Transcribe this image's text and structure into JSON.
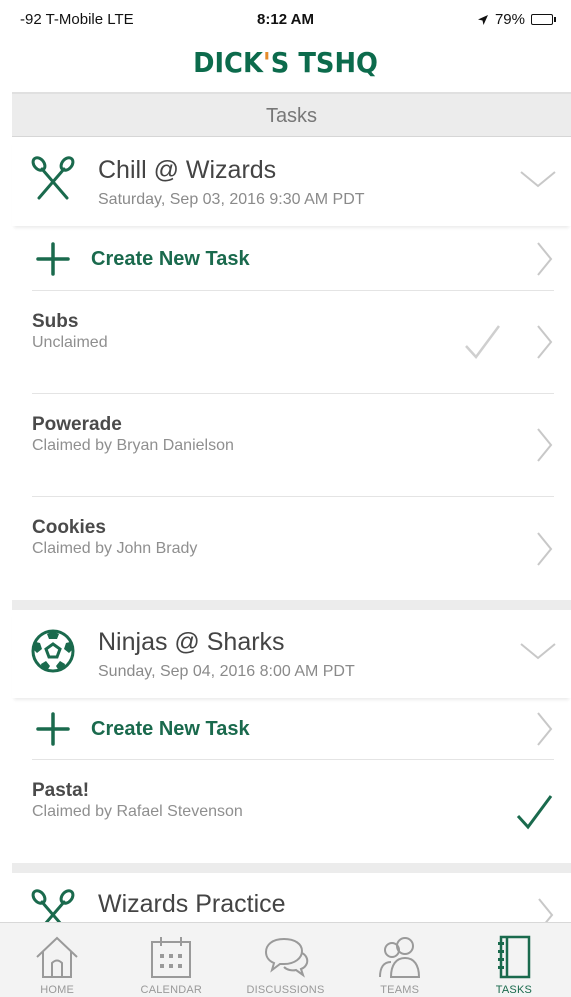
{
  "status_bar": {
    "carrier": "-92 T-Mobile  LTE",
    "time": "8:12 AM",
    "battery": "79%",
    "battery_level": 0.79
  },
  "brand": {
    "logo_part1": "DICK",
    "logo_apos": "'",
    "logo_part2": "S TSHQ",
    "primary_color": "#1a6a4d",
    "accent_color": "#e58b2b"
  },
  "header": {
    "title": "Tasks"
  },
  "events": [
    {
      "icon": "lacrosse-sticks-icon",
      "title": "Chill @ Wizards",
      "date": "Saturday, Sep 03, 2016 9:30 AM PDT",
      "create_label": "Create New Task",
      "tasks": [
        {
          "title": "Subs",
          "status": "Unclaimed",
          "claimed_by_me": false,
          "show_check": true
        },
        {
          "title": "Powerade",
          "status": "Claimed by Bryan Danielson",
          "claimed_by_me": false,
          "show_check": false
        },
        {
          "title": "Cookies",
          "status": "Claimed by John Brady",
          "claimed_by_me": false,
          "show_check": false
        }
      ]
    },
    {
      "icon": "soccer-ball-icon",
      "title": "Ninjas @ Sharks",
      "date": "Sunday, Sep 04, 2016 8:00 AM PDT",
      "create_label": "Create New Task",
      "tasks": [
        {
          "title": "Pasta!",
          "status": "Claimed by Rafael Stevenson",
          "claimed_by_me": true,
          "show_check": true
        }
      ]
    },
    {
      "icon": "lacrosse-sticks-icon",
      "title": "Wizards Practice"
    }
  ],
  "tab_bar": {
    "active": "tasks",
    "items": [
      {
        "id": "home",
        "label": "HOME",
        "icon": "home-icon"
      },
      {
        "id": "calendar",
        "label": "CALENDAR",
        "icon": "calendar-icon"
      },
      {
        "id": "discussions",
        "label": "DISCUSSIONS",
        "icon": "chat-bubbles-icon"
      },
      {
        "id": "teams",
        "label": "TEAMS",
        "icon": "people-icon"
      },
      {
        "id": "tasks",
        "label": "TASKS",
        "icon": "notebook-icon"
      }
    ]
  }
}
